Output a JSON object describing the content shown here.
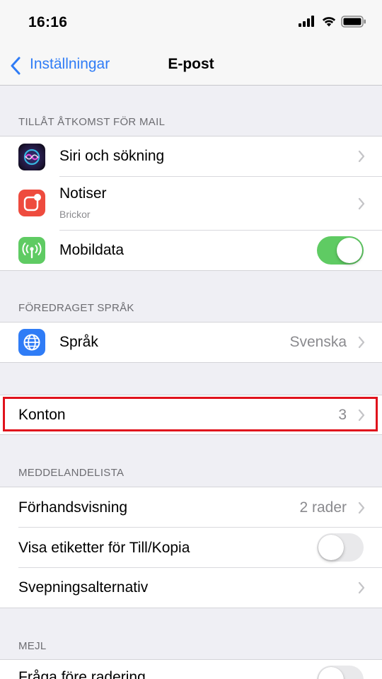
{
  "status_bar": {
    "time": "16:16"
  },
  "nav": {
    "back_label": "Inställningar",
    "title": "E-post"
  },
  "section_access": {
    "header": "TILLÅT ÅTKOMST FÖR MAIL",
    "siri_label": "Siri och sökning",
    "notiser_label": "Notiser",
    "notiser_sub": "Brickor",
    "mobildata_label": "Mobildata",
    "mobildata_on": true
  },
  "section_language": {
    "header": "FÖREDRAGET SPRÅK",
    "sprak_label": "Språk",
    "sprak_value": "Svenska"
  },
  "section_accounts": {
    "konton_label": "Konton",
    "konton_value": "3"
  },
  "section_list": {
    "header": "MEDDELANDELISTA",
    "preview_label": "Förhandsvisning",
    "preview_value": "2 rader",
    "labels_label": "Visa etiketter för Till/Kopia",
    "labels_on": false,
    "swipe_label": "Svepningsalternativ"
  },
  "section_mail": {
    "header": "MEJL",
    "ask_delete_label": "Fråga före radering",
    "ask_delete_on": false
  },
  "colors": {
    "ios_blue": "#2f7cf6",
    "toggle_on": "#5fcb63",
    "highlight": "#e0121c"
  }
}
